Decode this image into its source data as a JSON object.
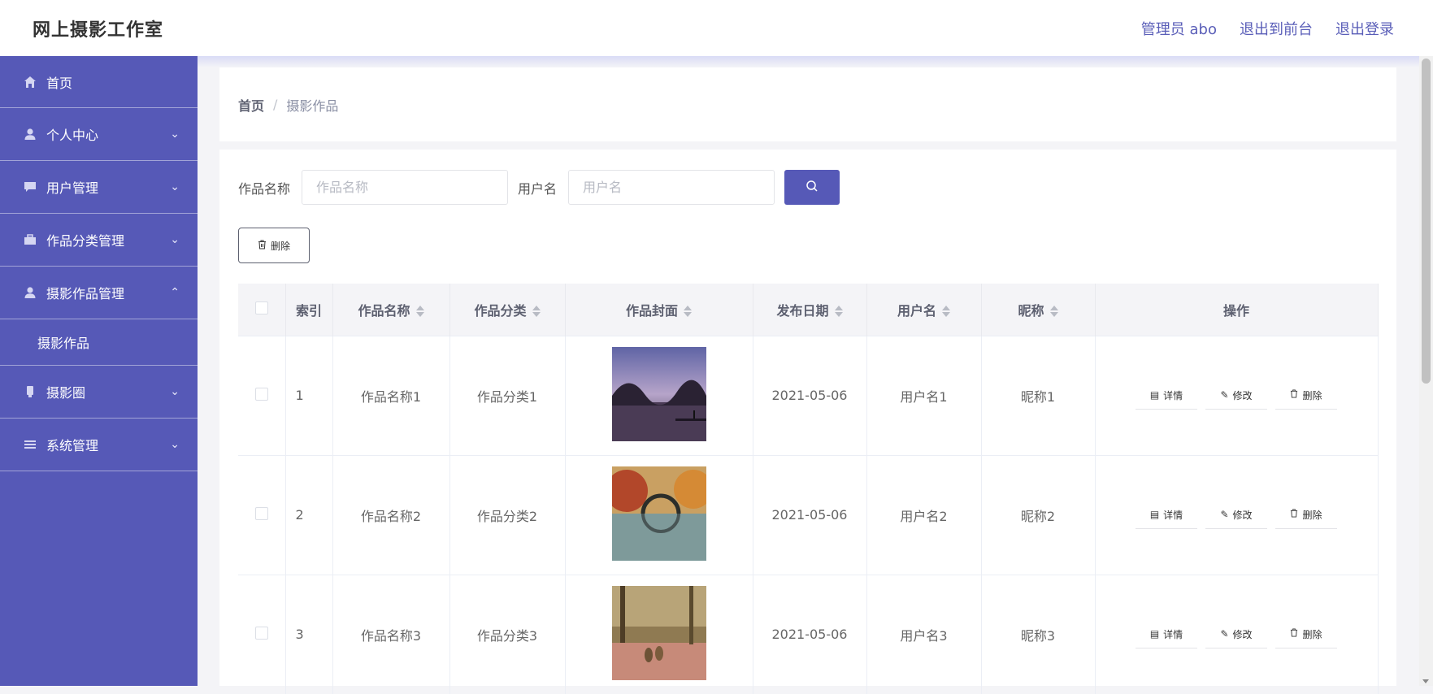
{
  "header": {
    "brand": "网上摄影工作室",
    "admin": "管理员 abo",
    "to_front": "退出到前台",
    "logout": "退出登录"
  },
  "sidebar": {
    "items": [
      {
        "label": "首页",
        "icon": "home-icon"
      },
      {
        "label": "个人中心",
        "icon": "user-icon"
      },
      {
        "label": "用户管理",
        "icon": "chat-icon"
      },
      {
        "label": "作品分类管理",
        "icon": "briefcase-icon"
      },
      {
        "label": "摄影作品管理",
        "icon": "user-icon"
      },
      {
        "label": "摄影圈",
        "icon": "phone-icon"
      },
      {
        "label": "系统管理",
        "icon": "list-icon"
      }
    ],
    "sub_item": "摄影作品"
  },
  "breadcrumb": {
    "home": "首页",
    "sep": "/",
    "current": "摄影作品"
  },
  "search": {
    "name_label": "作品名称",
    "name_placeholder": "作品名称",
    "user_label": "用户名",
    "user_placeholder": "用户名"
  },
  "toolbar": {
    "delete_label": "删除"
  },
  "table": {
    "headers": [
      "索引",
      "作品名称",
      "作品分类",
      "作品封面",
      "发布日期",
      "用户名",
      "昵称",
      "操作"
    ],
    "rows": [
      {
        "index": "1",
        "name": "作品名称1",
        "category": "作品分类1",
        "date": "2021-05-06",
        "username": "用户名1",
        "nickname": "昵称1"
      },
      {
        "index": "2",
        "name": "作品名称2",
        "category": "作品分类2",
        "date": "2021-05-06",
        "username": "用户名2",
        "nickname": "昵称2"
      },
      {
        "index": "3",
        "name": "作品名称3",
        "category": "作品分类3",
        "date": "2021-05-06",
        "username": "用户名3",
        "nickname": "昵称3"
      }
    ],
    "actions": {
      "detail": "详情",
      "edit": "修改",
      "delete": "删除"
    }
  },
  "colors": {
    "accent": "#5659b7"
  }
}
